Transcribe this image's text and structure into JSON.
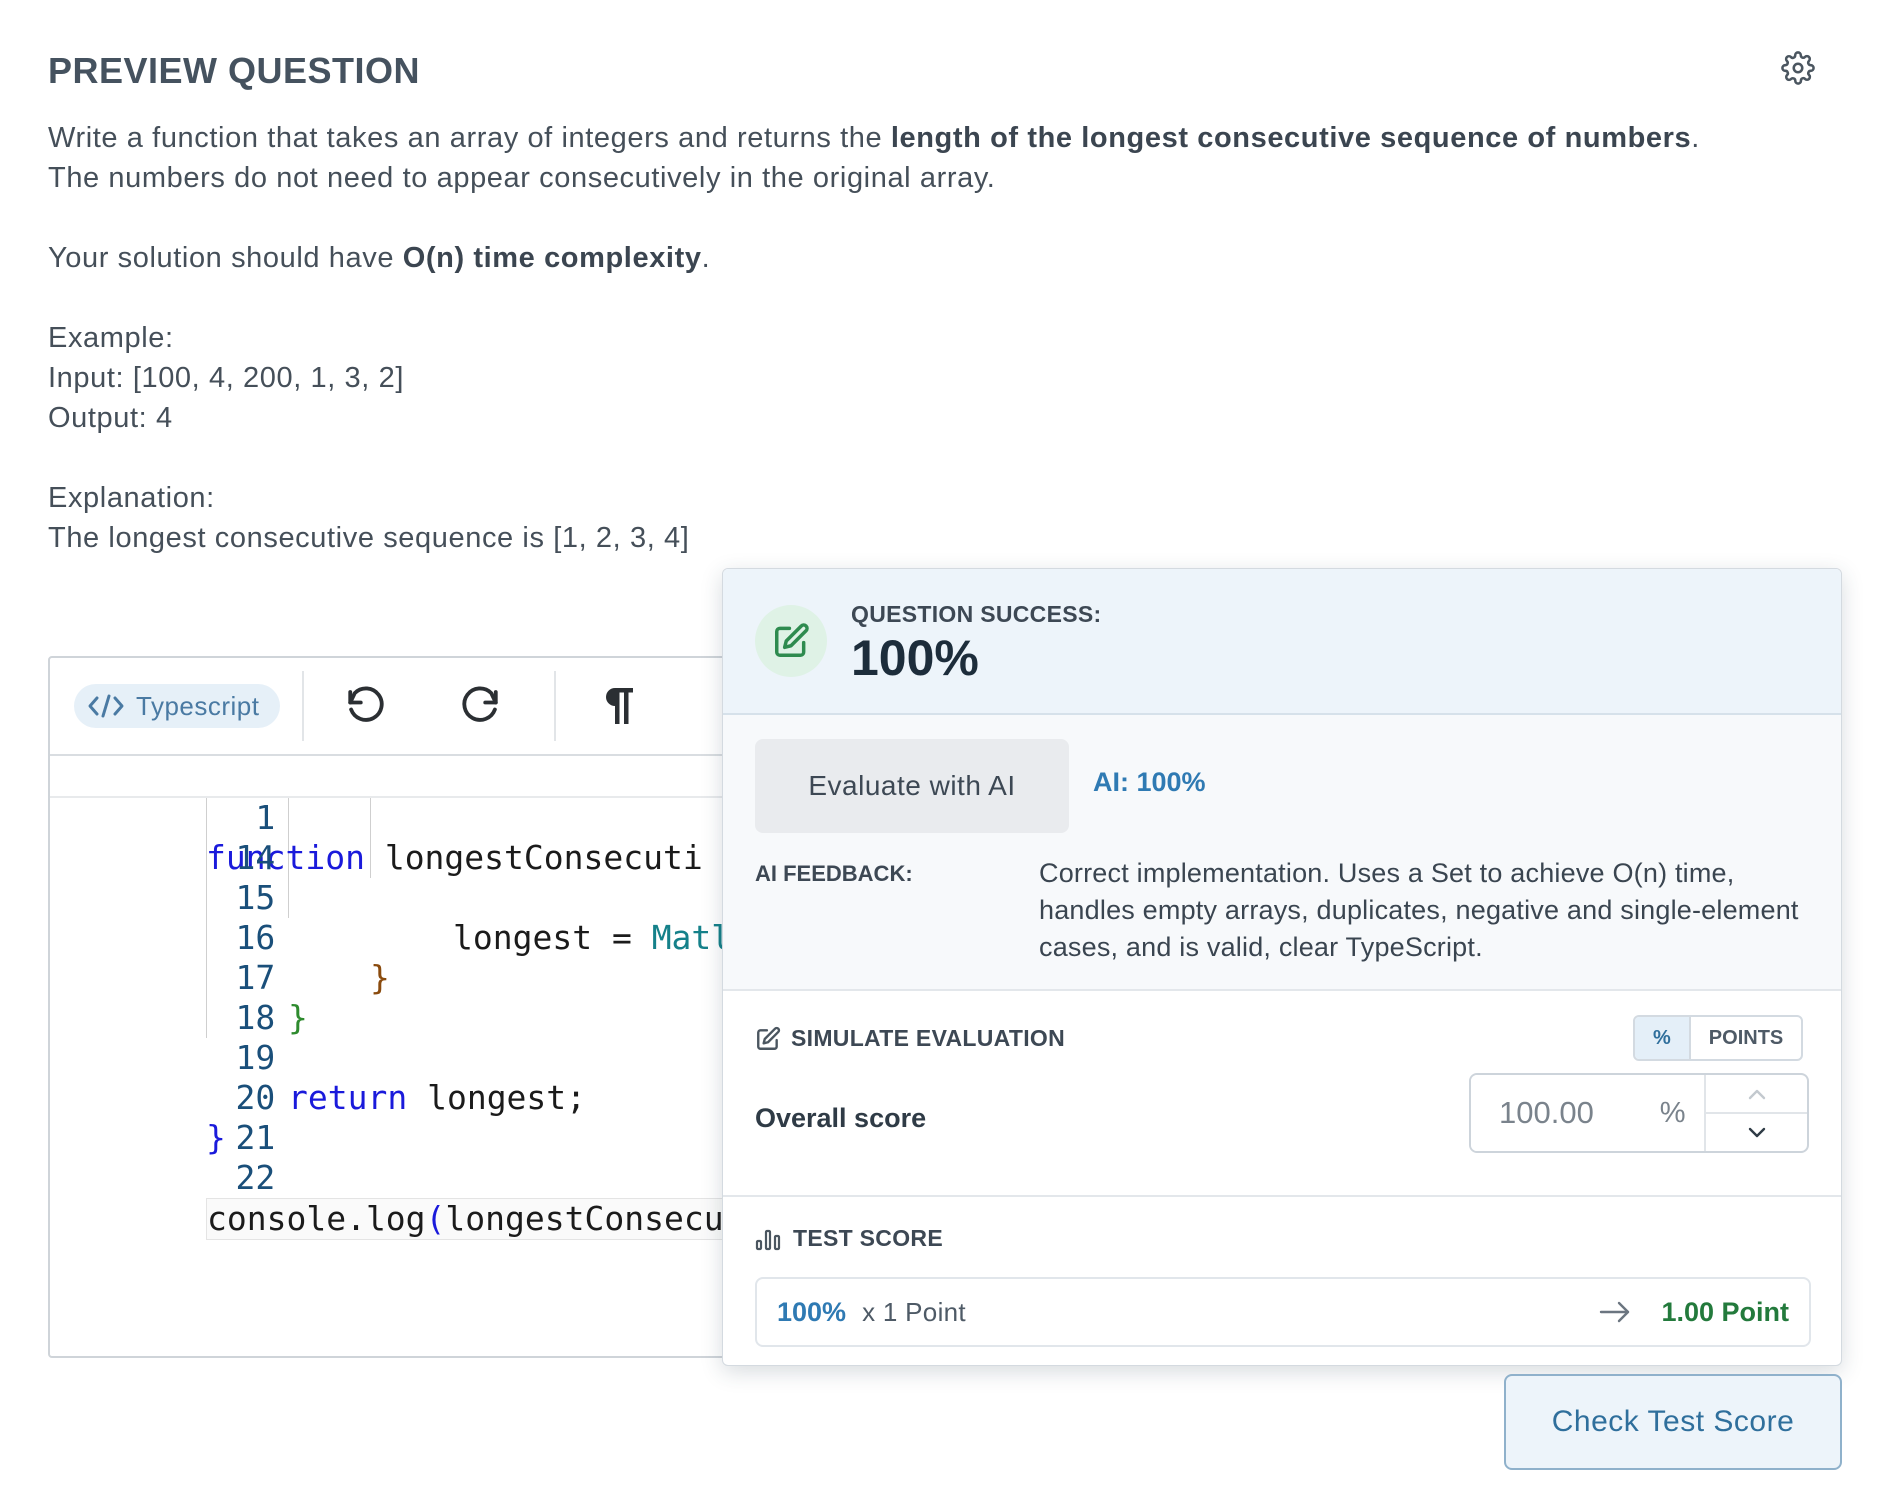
{
  "page": {
    "title": "PREVIEW QUESTION"
  },
  "question": {
    "line1_prefix": "Write a function that takes an array of integers and returns the ",
    "line1_bold": "length of the longest consecutive sequence of numbers",
    "line1_suffix": ".",
    "line2": "The numbers do not need to appear consecutively in the original array.",
    "complexity_prefix": "Your solution should have ",
    "complexity_bold": "O(n) time complexity",
    "complexity_suffix": ".",
    "example_label": "Example:",
    "example_input": "Input: [100, 4, 200, 1, 3, 2]",
    "example_output": "Output: 4",
    "explanation_label": "Explanation:",
    "explanation_text": "The longest consecutive sequence is [1, 2, 3, 4]"
  },
  "editor": {
    "language": "Typescript",
    "lines": [
      {
        "num": "1",
        "kw": "function",
        "rest": " longestConsecuti"
      },
      {
        "num": "14",
        "text": ""
      },
      {
        "num": "15",
        "pre": "longest = ",
        "teal": "Matl"
      },
      {
        "num": "16",
        "brace": "}"
      },
      {
        "num": "17",
        "brace": "}"
      },
      {
        "num": "18",
        "text": ""
      },
      {
        "num": "19",
        "kw": "return",
        "rest": " longest;"
      },
      {
        "num": "20",
        "brace": "}"
      },
      {
        "num": "21",
        "text": ""
      },
      {
        "num": "22",
        "pre": "console.log",
        "paren": "(",
        "rest": "longestConsecu"
      }
    ]
  },
  "popover": {
    "success_label": "QUESTION SUCCESS:",
    "success_value": "100%",
    "evaluate_button": "Evaluate with AI",
    "ai_score": "AI: 100%",
    "feedback_label": "AI FEEDBACK:",
    "feedback_text": "Correct implementation. Uses a Set to achieve O(n) time, handles empty arrays, duplicates, negative and single-element cases, and is valid, clear TypeScript.",
    "simulate_title": "SIMULATE EVALUATION",
    "unit_percent": "%",
    "unit_points": "POINTS",
    "overall_label": "Overall score",
    "overall_value": "100.00",
    "overall_unit": "%",
    "test_title": "TEST SCORE",
    "test_percent": "100%",
    "test_multiplier": "x 1 Point",
    "test_points": "1.00 Point"
  },
  "footer": {
    "check_button": "Check Test Score"
  },
  "colors": {
    "accent_blue": "#2f7ab3",
    "success_green": "#237a3c",
    "header_bg": "#edf4fa"
  }
}
